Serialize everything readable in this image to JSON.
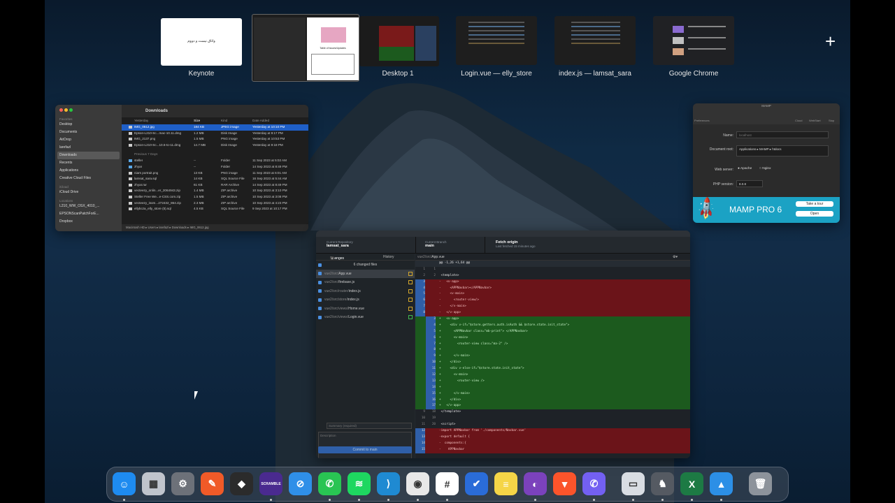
{
  "mission_control": {
    "spaces": [
      {
        "label": "Keynote",
        "preview_text": "واتاق نیست و دووم"
      },
      {
        "label": "",
        "preview_text": "Table of Issues/Updates"
      },
      {
        "label": "Desktop 1",
        "preview_text": ""
      },
      {
        "label": "Login.vue — elly_store",
        "preview_text": ""
      },
      {
        "label": "index.js — lamsat_sara",
        "preview_text": ""
      },
      {
        "label": "Google Chrome",
        "preview_text": ""
      }
    ],
    "add_space": "+"
  },
  "finder": {
    "title": "Downloads",
    "sidebar": {
      "header_favorites": "Favorites",
      "favorites": [
        "Desktop",
        "Documents",
        "AirDrop",
        "larefazl",
        "Downloads",
        "Recents",
        "Applications",
        "Creative Cloud Files"
      ],
      "header_locations": "iCloud",
      "icloud": [
        "iCloud Drive"
      ],
      "header_locations2": "Locations",
      "locations": [
        "L210_WW_OSX_4010_...",
        "EPSONScanPatchForE...",
        "Dropbox"
      ]
    },
    "columns": [
      "Name",
      "Size",
      "Kind",
      "Date Added"
    ],
    "group_yesterday": "Yesterday",
    "yesterday": [
      {
        "name": "IMG_0612.jpg",
        "size": "184 KB",
        "kind": "JPEG image",
        "date": "Yesterday at 10:10 PM"
      },
      {
        "name": "Epson-L210-Sc...mac-10.11.dmg",
        "size": "1.2 MB",
        "kind": "Disk Image",
        "date": "Yesterday at 9:17 PM"
      },
      {
        "name": "IMG_2137.png",
        "size": "1.5 MB",
        "kind": "PNG image",
        "date": "Yesterday at 10:53 PM"
      },
      {
        "name": "Epson-L210-Sc...10.6-to-11.dmg",
        "size": "14.7 MB",
        "kind": "Disk Image",
        "date": "Yesterday at 9:18 PM"
      }
    ],
    "group_prev": "Previous 7 Days",
    "previous": [
      {
        "name": "steller",
        "size": "--",
        "kind": "Folder",
        "date": "11 Sep 2023 at 5:02 AM"
      },
      {
        "name": "zhyar",
        "size": "--",
        "kind": "Folder",
        "date": "14 Sep 2023 at 8:49 PM"
      },
      {
        "name": "niars portrait.png",
        "size": "13 KB",
        "kind": "PNG image",
        "date": "11 Sep 2023 at 6:01 AM"
      },
      {
        "name": "lamsat_sara.sql",
        "size": "14 KB",
        "kind": "SQL Source File",
        "date": "16 Sep 2023 at 5:44 AM"
      },
      {
        "name": "zhyar.rar",
        "size": "61 KB",
        "kind": "RAR Archive",
        "date": "14 Sep 2023 at 8:49 PM"
      },
      {
        "name": "vecteezy_onlin...er_2064943.zip",
        "size": "1.4 MB",
        "kind": "ZIP archive",
        "date": "10 Sep 2023 at 3:10 PM"
      },
      {
        "name": "Steller Free We...e-CSS.com.zip",
        "size": "1.5 MB",
        "kind": "ZIP archive",
        "date": "10 Sep 2023 at 3:08 PM"
      },
      {
        "name": "vecteezy_isom...272432_864.zip",
        "size": "2.3 MB",
        "kind": "ZIP archive",
        "date": "10 Sep 2023 at 4:23 PM"
      },
      {
        "name": "ellybcza_elly_store (5).sql",
        "size": "4.5 KB",
        "kind": "SQL Source File",
        "date": "9 Sep 2023 at 10:17 PM"
      }
    ],
    "path_bar": "Macintosh HD ▸ Users ▸ larefazl ▸ Downloads ▸ IMG_0612.jpg"
  },
  "mamp": {
    "title": "MAMP",
    "toolbar": [
      "Preferences",
      "Cloud",
      "WebStart",
      "Stop"
    ],
    "name_label": "Name:",
    "name_value": "localhost",
    "docroot_label": "Document root:",
    "docroot_value": "Applications ▸ MAMP ▸ htdocs",
    "webserver_label": "Web server:",
    "webserver_options": [
      "Apache",
      "Nginx"
    ],
    "php_label": "PHP version:",
    "php_value": "8.0.8",
    "banner_text": "MAMP PRO 6",
    "tour_button": "Take a tour",
    "open_button": "Open"
  },
  "github": {
    "repo_label": "Current Repository",
    "repo_name": "lamsat_sara",
    "branch_label": "Current Branch",
    "branch_name": "main",
    "fetch_title": "Fetch origin",
    "fetch_sub": "Last fetched 15 minutes ago",
    "tab_changes": "Changes",
    "tab_changes_count": "6",
    "tab_history": "History",
    "changed_files": "6 changed files",
    "files": [
      {
        "dir": "vue2/src/",
        "name": "App.vue"
      },
      {
        "dir": "vue2/src/",
        "name": "firebase.js"
      },
      {
        "dir": "vue2/src/router/",
        "name": "index.js"
      },
      {
        "dir": "vue2/src/store/",
        "name": "index.js"
      },
      {
        "dir": "vue2/src/views/",
        "name": "Home.vue"
      },
      {
        "dir": "vue2/src/views/",
        "name": "Login.vue"
      }
    ],
    "diff_path_dir": "vue2/src/",
    "diff_path_file": "App.vue",
    "summary_placeholder": "Summary (required)",
    "description_placeholder": "Description",
    "commit_button": "Commit to main",
    "diff_lines": [
      {
        "t": "hunk",
        "a": "",
        "b": "",
        "c": "@@ -1,26 +1,64 @@"
      },
      {
        "t": "ctx",
        "a": "1",
        "b": "1",
        "c": ""
      },
      {
        "t": "ctx",
        "a": "2",
        "b": "2",
        "c": " <template>"
      },
      {
        "t": "del",
        "a": "3",
        "b": "",
        "c": "-   <v-app>"
      },
      {
        "t": "del",
        "a": "4",
        "b": "",
        "c": "-     <APPNavbar></APPNavbar>"
      },
      {
        "t": "del",
        "a": "5",
        "b": "",
        "c": "-     <v-main>"
      },
      {
        "t": "del",
        "a": "6",
        "b": "",
        "c": "-       <router-view/>"
      },
      {
        "t": "del",
        "a": "7",
        "b": "",
        "c": "-     </v-main>"
      },
      {
        "t": "del",
        "a": "8",
        "b": "",
        "c": "-   </v-app>"
      },
      {
        "t": "add",
        "a": "",
        "b": "3",
        "c": "+   <v-app>"
      },
      {
        "t": "add",
        "a": "",
        "b": "4",
        "c": "+     <div v-if=\"$store.getters.auth.isAuth && $store.state.init_state\">"
      },
      {
        "t": "add",
        "a": "",
        "b": "5",
        "c": "+       <APPNavbar class=\"mb-print\"> </APPNavbar>"
      },
      {
        "t": "add",
        "a": "",
        "b": "6",
        "c": "+       <v-main>"
      },
      {
        "t": "add",
        "a": "",
        "b": "7",
        "c": "+         <router-view class=\"ma-2\" />"
      },
      {
        "t": "add",
        "a": "",
        "b": "8",
        "c": "+"
      },
      {
        "t": "add",
        "a": "",
        "b": "9",
        "c": "+       </v-main>"
      },
      {
        "t": "add",
        "a": "",
        "b": "10",
        "c": "+     </div>"
      },
      {
        "t": "add",
        "a": "",
        "b": "11",
        "c": "+     <div v-else-if=\"$store.state.init_state\">"
      },
      {
        "t": "add",
        "a": "",
        "b": "12",
        "c": "+       <v-main>"
      },
      {
        "t": "add",
        "a": "",
        "b": "13",
        "c": "+         <router-view />"
      },
      {
        "t": "add",
        "a": "",
        "b": "14",
        "c": "+"
      },
      {
        "t": "add",
        "a": "",
        "b": "15",
        "c": "+       </v-main>"
      },
      {
        "t": "add",
        "a": "",
        "b": "16",
        "c": "+     </div>"
      },
      {
        "t": "add",
        "a": "",
        "b": "17",
        "c": "+   </v-app>"
      },
      {
        "t": "ctx",
        "a": "9",
        "b": "18",
        "c": " </template>"
      },
      {
        "t": "ctx",
        "a": "10",
        "b": "19",
        "c": ""
      },
      {
        "t": "ctx",
        "a": "11",
        "b": "20",
        "c": " <script>"
      },
      {
        "t": "del",
        "a": "12",
        "b": "",
        "c": "-import APPNavbar from './components/Navbar.vue'"
      },
      {
        "t": "del",
        "a": "13",
        "b": "",
        "c": "-export default {"
      },
      {
        "t": "del",
        "a": "14",
        "b": "",
        "c": "-  components:{"
      },
      {
        "t": "del",
        "a": "15",
        "b": "",
        "c": "-    APPNavbar"
      }
    ]
  },
  "dock": {
    "apps": [
      {
        "name": "Finder",
        "glyph": "☺",
        "color": "#1e8bf0",
        "running": true
      },
      {
        "name": "Launchpad",
        "glyph": "▦",
        "color": "#c0c4cc",
        "running": false
      },
      {
        "name": "System Settings",
        "glyph": "⚙",
        "color": "#6d7179",
        "running": false
      },
      {
        "name": "Pen",
        "glyph": "✎",
        "color": "#f05a28",
        "running": false
      },
      {
        "name": "Figma",
        "glyph": "◆",
        "color": "#2b2b2b",
        "running": false
      },
      {
        "name": "Scramble",
        "glyph": "SCRAMBLE",
        "color": "#4a2a8f",
        "running": true
      },
      {
        "name": "Safari",
        "glyph": "⊘",
        "color": "#2f8fe8",
        "running": false
      },
      {
        "name": "WhatsApp",
        "glyph": "✆",
        "color": "#29c453",
        "running": true
      },
      {
        "name": "Spotify",
        "glyph": "≋",
        "color": "#1ed760",
        "running": true
      },
      {
        "name": "VS Code",
        "glyph": "⟩",
        "color": "#1f8ad2",
        "running": true
      },
      {
        "name": "Google Chrome",
        "glyph": "◉",
        "color": "#e8e8e8",
        "running": true
      },
      {
        "name": "Slack",
        "glyph": "#",
        "color": "#ffffff",
        "running": true
      },
      {
        "name": "Tasks",
        "glyph": "✔",
        "color": "#2a6cd8",
        "running": false
      },
      {
        "name": "Notes",
        "glyph": "≡",
        "color": "#f5d547",
        "running": false
      },
      {
        "name": "GitHub Desktop",
        "glyph": "◐",
        "color": "#7b42bc",
        "running": true
      },
      {
        "name": "Brave",
        "glyph": "▼",
        "color": "#fb542b",
        "running": false
      },
      {
        "name": "Viber",
        "glyph": "✆",
        "color": "#7360f2",
        "running": true
      },
      {
        "name": "Preview",
        "glyph": "▭",
        "color": "#d9dde3",
        "running": true
      },
      {
        "name": "MAMP",
        "glyph": "♞",
        "color": "#555a62",
        "running": true
      },
      {
        "name": "Excel",
        "glyph": "X",
        "color": "#1d7a44",
        "running": true
      },
      {
        "name": "Keynote",
        "glyph": "▲",
        "color": "#2c8fe6",
        "running": true
      },
      {
        "name": "Trash",
        "glyph": "🗑",
        "color": "#8d939b",
        "running": false
      }
    ]
  }
}
